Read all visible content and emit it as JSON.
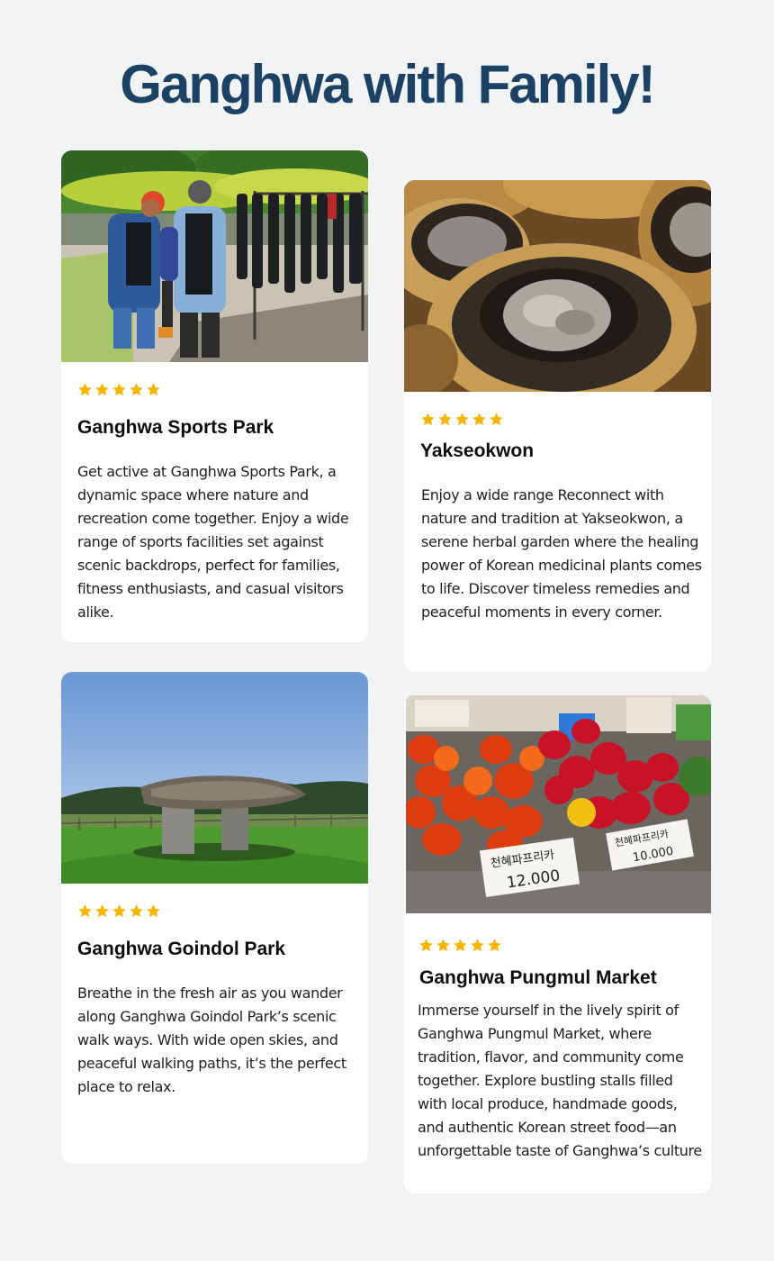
{
  "page": {
    "title": "Ganghwa with Family!"
  },
  "colors": {
    "background": "#f1f3f5",
    "title": "#1b4265",
    "star": "#f7b500",
    "card": "#ffffff"
  },
  "cards": [
    {
      "title": "Ganghwa Sports Park",
      "rating": 5,
      "image": "zipline-harness-photo",
      "description": "Get active at Ganghwa Sports Park, a dynamic space where nature and recreation come together. Enjoy a wide range of sports facilities set against scenic backdrops, perfect for families, fitness enthusiasts, and casual visitors alike."
    },
    {
      "title": "Yakseokwon",
      "rating": 5,
      "image": "herbal-pots-photo",
      "description": "Enjoy a wide range Reconnect with nature and tradition at Yakseokwon, a serene herbal garden where the healing power of Korean medicinal plants comes to life. Discover timeless remedies and peaceful moments in every corner."
    },
    {
      "title": "Ganghwa Goindol Park",
      "rating": 5,
      "image": "dolmen-photo",
      "description": "Breathe in the fresh air as you wander along Ganghwa Goindol Park’s scenic walk ways. With wide open skies, and peaceful walking paths, it’s the perfect place to relax."
    },
    {
      "title": "Ganghwa Pungmul Market",
      "rating": 5,
      "image": "market-peppers-photo",
      "description": "Immerse yourself in the lively spirit of Ganghwa Pungmul Market, where tradition, flavor, and community come together. Explore bustling stalls filled with local produce, handmade goods, and authentic Korean street food—an unforgettable taste of Ganghwa’s culture"
    }
  ],
  "photo_text": {
    "price_left_sign": "천혜파프리카",
    "price_left_value": "12.000",
    "price_right_sign": "천혜파프리카",
    "price_right_value": "10.000"
  }
}
